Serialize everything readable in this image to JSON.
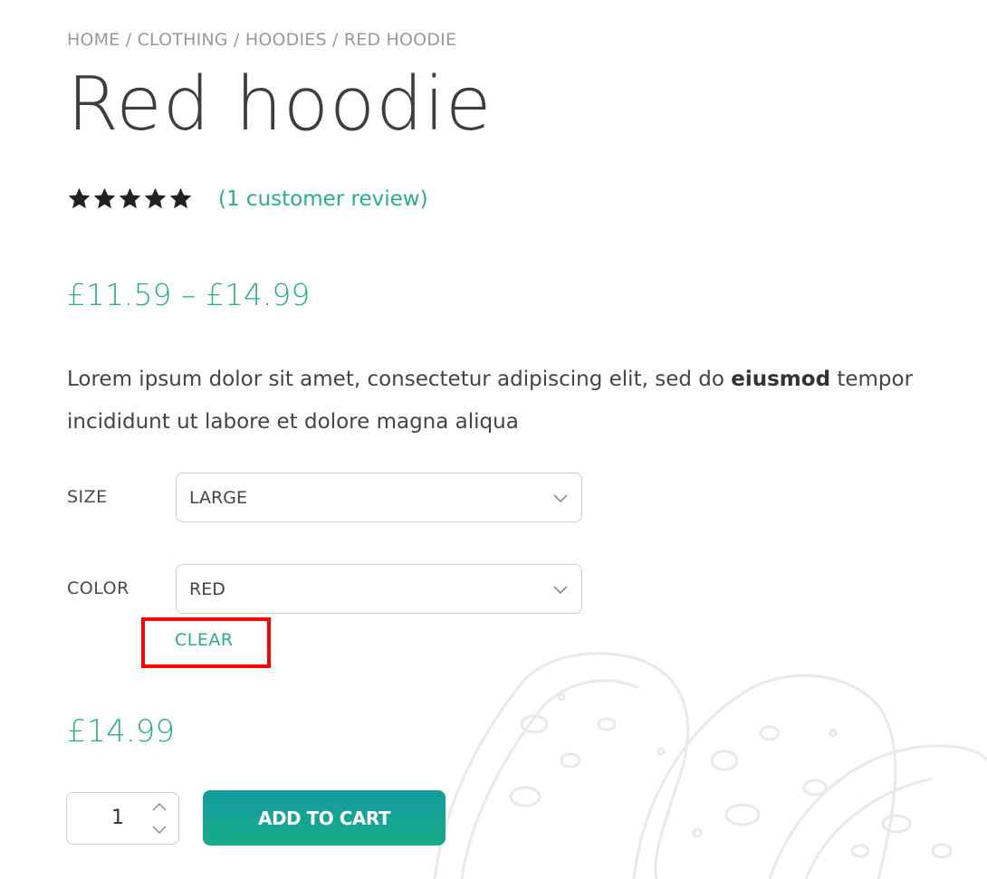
{
  "breadcrumb": {
    "items": [
      "HOME",
      "CLOTHING",
      "HOODIES",
      "RED HOODIE"
    ],
    "separator": "/"
  },
  "product": {
    "title": "Red hoodie",
    "rating_stars": 5,
    "rating_max": 5,
    "review_link": "(1 customer review)",
    "price_range": "£11.59 – £14.99",
    "description_part1": "Lorem ipsum dolor sit amet, consectetur adipiscing elit, sed do ",
    "description_bold": "eiusmod",
    "description_part2": " tempor incididunt ut labore et dolore magna aliqua"
  },
  "variations": {
    "size": {
      "label": "SIZE",
      "selected": "LARGE"
    },
    "color": {
      "label": "COLOR",
      "selected": "RED"
    },
    "clear_label": "CLEAR"
  },
  "selected_price": "£14.99",
  "cart": {
    "quantity": "1",
    "add_button_label": "ADD TO CART"
  },
  "colors": {
    "accent": "#27ae8c",
    "button_gradient_top": "#129b9e",
    "button_gradient_bottom": "#17ad88",
    "highlight_box": "#ff0000"
  },
  "icons": {
    "star": "star-icon",
    "dropdown": "chevron-down-icon",
    "qty_up": "chevron-up-icon",
    "qty_down": "chevron-down-icon"
  }
}
